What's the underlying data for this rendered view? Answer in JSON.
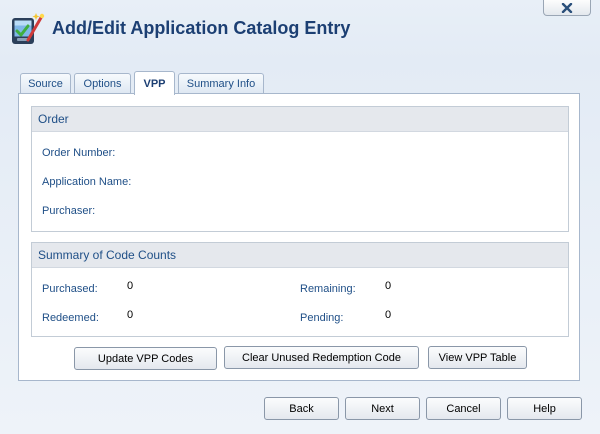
{
  "window": {
    "title": "Add/Edit Application Catalog Entry",
    "close_label": "×"
  },
  "tabs": [
    {
      "label": "Source",
      "active": false
    },
    {
      "label": "Options",
      "active": false
    },
    {
      "label": "VPP",
      "active": true
    },
    {
      "label": "Summary Info",
      "active": false
    }
  ],
  "order": {
    "heading": "Order",
    "order_number_label": "Order Number:",
    "order_number_value": "",
    "application_name_label": "Application Name:",
    "application_name_value": "",
    "purchaser_label": "Purchaser:",
    "purchaser_value": ""
  },
  "code_counts": {
    "heading": "Summary of Code Counts",
    "purchased_label": "Purchased:",
    "purchased_value": "0",
    "remaining_label": "Remaining:",
    "remaining_value": "0",
    "redeemed_label": "Redeemed:",
    "redeemed_value": "0",
    "pending_label": "Pending:",
    "pending_value": "0"
  },
  "actions": {
    "update_vpp_codes": "Update VPP Codes",
    "clear_unused_redemption_code": "Clear Unused Redemption Code",
    "view_vpp_table": "View VPP Table"
  },
  "footer": {
    "back": "Back",
    "next": "Next",
    "cancel": "Cancel",
    "help": "Help"
  },
  "colors": {
    "title": "#1c3f73",
    "label": "#1f4f87",
    "section_header_bg": "#e5e8ed",
    "close_icon": "#2a4f7a"
  },
  "icons": {
    "title_icon": "app-catalog-wand-icon",
    "close_icon": "close-icon"
  }
}
